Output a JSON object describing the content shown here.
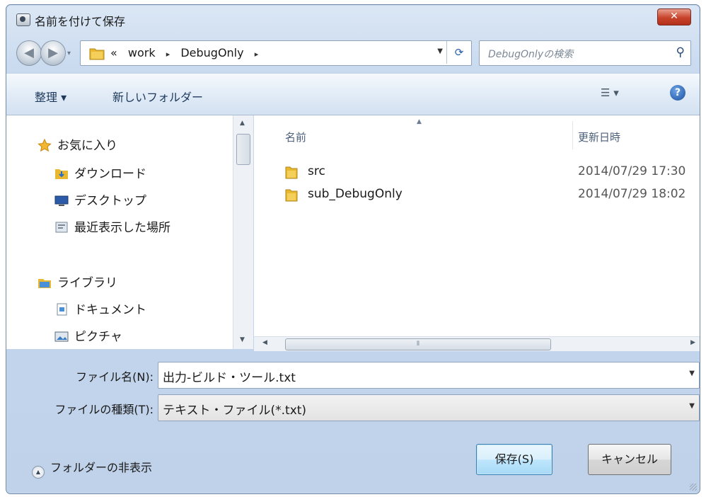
{
  "window": {
    "title": "名前を付けて保存",
    "close_label": "✕"
  },
  "address": {
    "overflow": "«",
    "crumbs": [
      "work",
      "DebugOnly"
    ],
    "separator": "▸"
  },
  "search": {
    "placeholder": "DebugOnlyの検索"
  },
  "toolbar": {
    "organize": "整理 ▾",
    "new_folder": "新しいフォルダー",
    "views": "☰ ▾",
    "help": "?"
  },
  "nav": {
    "favorites": "お気に入り",
    "downloads": "ダウンロード",
    "desktop": "デスクトップ",
    "recent": "最近表示した場所",
    "libraries": "ライブラリ",
    "documents": "ドキュメント",
    "pictures": "ピクチャ"
  },
  "files": {
    "col_name": "名前",
    "col_date": "更新日時",
    "rows": [
      {
        "name": "src",
        "date": "2014/07/29 17:30"
      },
      {
        "name": "sub_DebugOnly",
        "date": "2014/07/29 18:02"
      }
    ]
  },
  "form": {
    "filename_label": "ファイル名(N):",
    "filename_value": "出力-ビルド・ツール.txt",
    "filetype_label": "ファイルの種類(T):",
    "filetype_value": "テキスト・ファイル(*.txt)"
  },
  "footer": {
    "hide_folders": "フォルダーの非表示",
    "save": "保存(S)",
    "cancel": "キャンセル"
  },
  "colors": {
    "accent": "#3c7fb1",
    "folder": "#e8b830"
  }
}
